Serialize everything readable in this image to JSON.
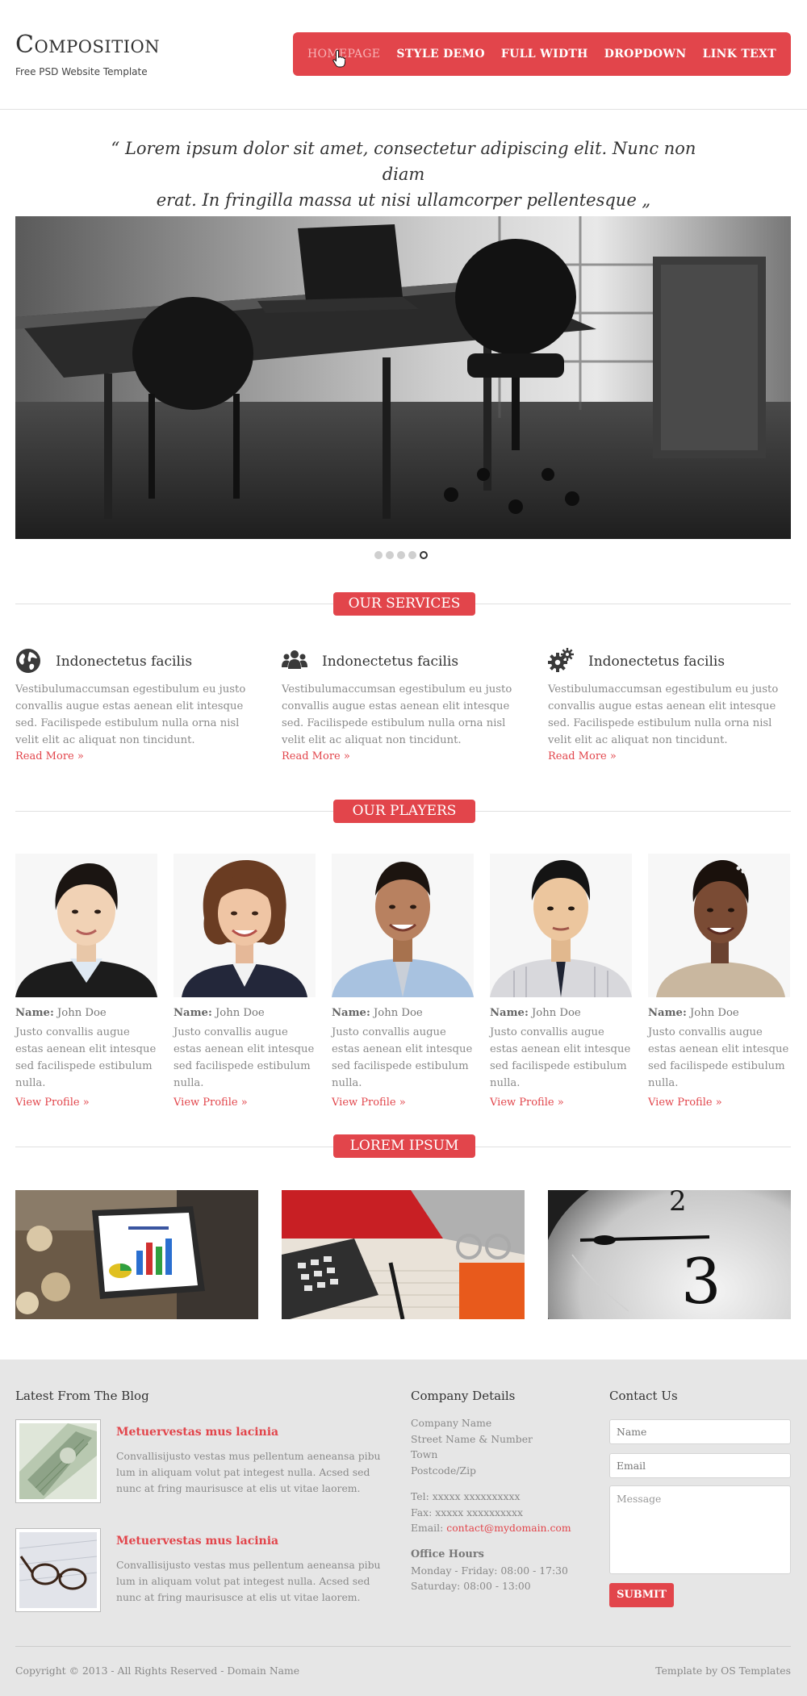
{
  "header": {
    "logo": "Composition",
    "tagline": "Free PSD Website Template"
  },
  "nav": {
    "items": [
      {
        "label": "Homepage",
        "active": true
      },
      {
        "label": "Style Demo",
        "active": false
      },
      {
        "label": "Full Width",
        "active": false
      },
      {
        "label": "Dropdown",
        "active": false
      },
      {
        "label": "Link Text",
        "active": false
      }
    ]
  },
  "quote": {
    "line1": "“ Lorem ipsum dolor sit amet, consectetur adipiscing elit. Nunc non diam",
    "line2": "erat. In fringilla massa ut nisi ullamcorper pellentesque „"
  },
  "slider": {
    "slide_count": 5,
    "active_slide": 5
  },
  "sections": {
    "services": "Our Services",
    "players": "Our Players",
    "gallery": "Lorem Ipsum"
  },
  "services": [
    {
      "icon": "globe-icon",
      "title": "Indonectetus facilis",
      "text": "Vestibulumaccumsan egestibulum eu justo convallis augue estas aenean elit intesque sed. Facilispede estibulum nulla orna nisl velit elit ac aliquat non tincidunt.",
      "link": "Read More »"
    },
    {
      "icon": "users-icon",
      "title": "Indonectetus facilis",
      "text": "Vestibulumaccumsan egestibulum eu justo convallis augue estas aenean elit intesque sed. Facilispede estibulum nulla orna nisl velit elit ac aliquat non tincidunt.",
      "link": "Read More »"
    },
    {
      "icon": "gears-icon",
      "title": "Indonectetus facilis",
      "text": "Vestibulumaccumsan egestibulum eu justo convallis augue estas aenean elit intesque sed. Facilispede estibulum nulla orna nisl velit elit ac aliquat non tincidunt.",
      "link": "Read More »"
    }
  ],
  "players": [
    {
      "name_label": "Name:",
      "name": "John Doe",
      "text": "Justo convallis augue estas aenean elit intesque sed facilispede estibulum nulla.",
      "link": "View Profile »"
    },
    {
      "name_label": "Name:",
      "name": "John Doe",
      "text": "Justo convallis augue estas aenean elit intesque sed facilispede estibulum nulla.",
      "link": "View Profile »"
    },
    {
      "name_label": "Name:",
      "name": "John Doe",
      "text": "Justo convallis augue estas aenean elit intesque sed facilispede estibulum nulla.",
      "link": "View Profile »"
    },
    {
      "name_label": "Name:",
      "name": "John Doe",
      "text": "Justo convallis augue estas aenean elit intesque sed facilispede estibulum nulla.",
      "link": "View Profile »"
    },
    {
      "name_label": "Name:",
      "name": "John Doe",
      "text": "Justo convallis augue estas aenean elit intesque sed facilispede estibulum nulla.",
      "link": "View Profile »"
    }
  ],
  "footer": {
    "blog_heading": "Latest From The Blog",
    "blog": [
      {
        "title": "Metuervestas mus lacinia",
        "text": "Convallisijusto vestas mus pellentum aeneansa pibu lum in aliquam volut pat integest nulla. Acsed sed nunc at fring maurisusce at elis ut vitae laorem."
      },
      {
        "title": "Metuervestas mus lacinia",
        "text": "Convallisijusto vestas mus pellentum aeneansa pibu lum in aliquam volut pat integest nulla. Acsed sed nunc at fring maurisusce at elis ut vitae laorem."
      }
    ],
    "company_heading": "Company Details",
    "company": {
      "name": "Company Name",
      "street": "Street Name & Number",
      "town": "Town",
      "postcode": "Postcode/Zip",
      "tel": "Tel: xxxxx xxxxxxxxxx",
      "fax": "Fax: xxxxx xxxxxxxxxx",
      "email_label": "Email:",
      "email": "contact@mydomain.com",
      "hours_heading": "Office Hours",
      "hours_weekday": "Monday - Friday: 08:00 - 17:30",
      "hours_saturday": "Saturday: 08:00 - 13:00"
    },
    "contact_heading": "Contact Us",
    "contact": {
      "name_placeholder": "Name",
      "email_placeholder": "Email",
      "message_placeholder": "Message",
      "submit": "Submit"
    },
    "copyright": "Copyright © 2013 - All Rights Reserved - Domain Name",
    "credit": "Template by OS Templates"
  },
  "colors": {
    "accent": "#e2454b",
    "footer_bg": "#e6e6e6",
    "muted_text": "#8a8a8a"
  }
}
